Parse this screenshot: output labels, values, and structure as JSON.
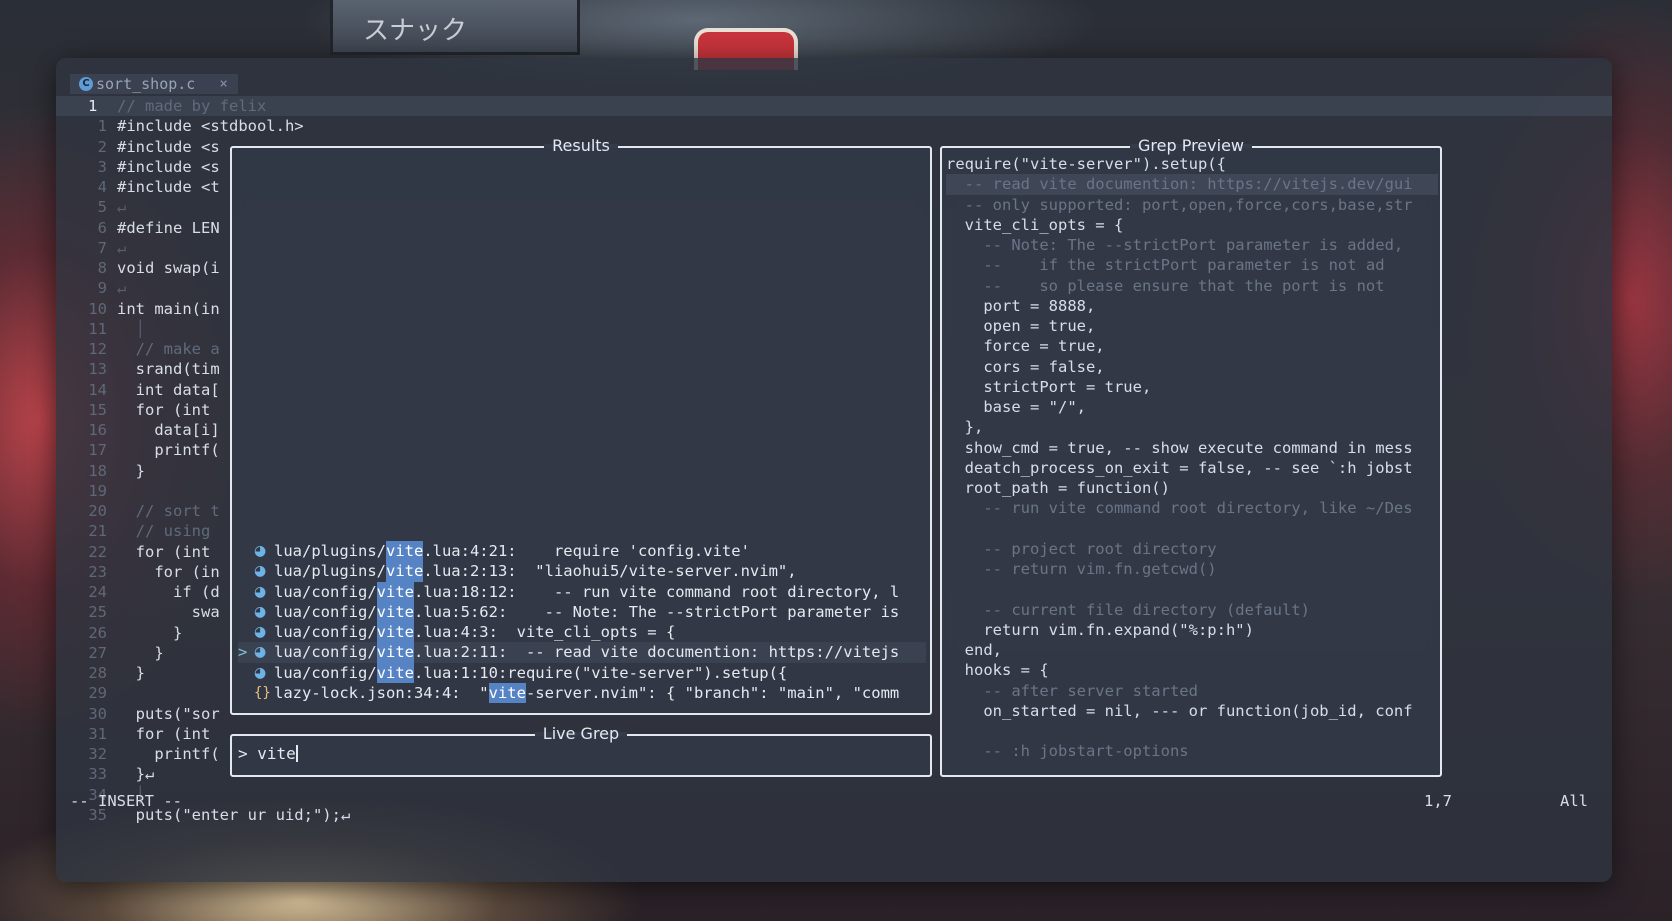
{
  "background": {
    "sign_text": "スナック"
  },
  "tab": {
    "filename": "sort_shop.c",
    "icon": "c-file-icon",
    "close_glyph": "×"
  },
  "editor": {
    "lines": [
      {
        "n": "1",
        "text": "// made by felix",
        "cls": "cmt",
        "cur": true
      },
      {
        "n": "1",
        "text": "#include <stdbool.h>"
      },
      {
        "n": "2",
        "text": "#include <s"
      },
      {
        "n": "3",
        "text": "#include <s"
      },
      {
        "n": "4",
        "text": "#include <t"
      },
      {
        "n": "5",
        "text": "↵",
        "cls": "eol"
      },
      {
        "n": "6",
        "text": "#define LEN"
      },
      {
        "n": "7",
        "text": "↵",
        "cls": "eol"
      },
      {
        "n": "8",
        "text": "void swap(i"
      },
      {
        "n": "9",
        "text": "↵",
        "cls": "eol"
      },
      {
        "n": "10",
        "text": "int main(in"
      },
      {
        "n": "11",
        "text": "  │",
        "cls": "guide"
      },
      {
        "n": "12",
        "text": "  // make a",
        "cls": "cmt"
      },
      {
        "n": "13",
        "text": "  srand(tim"
      },
      {
        "n": "14",
        "text": "  int data["
      },
      {
        "n": "15",
        "text": "  for (int "
      },
      {
        "n": "16",
        "text": "    data[i]"
      },
      {
        "n": "17",
        "text": "    printf("
      },
      {
        "n": "18",
        "text": "  }"
      },
      {
        "n": "19",
        "text": ""
      },
      {
        "n": "20",
        "text": "  // sort t",
        "cls": "cmt"
      },
      {
        "n": "21",
        "text": "  // using ",
        "cls": "cmt"
      },
      {
        "n": "22",
        "text": "  for (int "
      },
      {
        "n": "23",
        "text": "    for (in"
      },
      {
        "n": "24",
        "text": "      if (d"
      },
      {
        "n": "25",
        "text": "        swa"
      },
      {
        "n": "26",
        "text": "      }"
      },
      {
        "n": "27",
        "text": "    }"
      },
      {
        "n": "28",
        "text": "  }"
      },
      {
        "n": "29",
        "text": ""
      },
      {
        "n": "30",
        "text": "  puts(\"sor"
      },
      {
        "n": "31",
        "text": "  for (int "
      },
      {
        "n": "32",
        "text": "    printf("
      },
      {
        "n": "33",
        "text": "  }↵"
      },
      {
        "n": "34",
        "text": "  │",
        "cls": "guide"
      },
      {
        "n": "35",
        "text": "  puts(\"enter ur uid;\");↵"
      }
    ]
  },
  "status": {
    "mode": "-- INSERT --",
    "position": "1,7",
    "scroll": "All"
  },
  "results": {
    "title": "Results",
    "rows": [
      {
        "icon": "lua-icon",
        "glyph": "◕",
        "pre": "lua/plugins/",
        "match": "vite",
        "post": ".lua:4:21:    require 'config.vite'"
      },
      {
        "icon": "lua-icon",
        "glyph": "◕",
        "pre": "lua/plugins/",
        "match": "vite",
        "post": ".lua:2:13:  \"liaohui5/vite-server.nvim\","
      },
      {
        "icon": "lua-icon",
        "glyph": "◕",
        "pre": "lua/config/",
        "match": "vite",
        "post": ".lua:18:12:    -- run vite command root directory, l"
      },
      {
        "icon": "lua-icon",
        "glyph": "◕",
        "pre": "lua/config/",
        "match": "vite",
        "post": ".lua:5:62:    -- Note: The --strictPort parameter is"
      },
      {
        "icon": "lua-icon",
        "glyph": "◕",
        "pre": "lua/config/",
        "match": "vite",
        "post": ".lua:4:3:  vite_cli_opts = {"
      },
      {
        "icon": "lua-icon",
        "glyph": "◕",
        "pre": "lua/config/",
        "match": "vite",
        "post": ".lua:2:11:  -- read vite documention: https://vitejs",
        "selected": true
      },
      {
        "icon": "lua-icon",
        "glyph": "◕",
        "pre": "lua/config/",
        "match": "vite",
        "post": ".lua:1:10:require(\"vite-server\").setup({"
      },
      {
        "icon": "json-icon",
        "glyph": "{}",
        "pre": "lazy-lock.json:34:4:  \"",
        "match": "vite",
        "post": "-server.nvim\": { \"branch\": \"main\", \"comm"
      }
    ]
  },
  "preview": {
    "title": "Grep Preview",
    "lines": [
      "require(\"vite-server\").setup({",
      "  -- read vite documention: https://vitejs.dev/gui",
      "  -- only supported: port,open,force,cors,base,str",
      "  vite_cli_opts = {",
      "    -- Note: The --strictPort parameter is added,",
      "    --    if the strictPort parameter is not ad",
      "    --    so please ensure that the port is not",
      "    port = 8888,",
      "    open = true,",
      "    force = true,",
      "    cors = false,",
      "    strictPort = true,",
      "    base = \"/\",",
      "  },",
      "  show_cmd = true, -- show execute command in mess",
      "  deatch_process_on_exit = false, -- see `:h jobst",
      "  root_path = function()",
      "    -- run vite command root directory, like ~/Des",
      "",
      "    -- project root directory",
      "    -- return vim.fn.getcwd()",
      "",
      "    -- current file directory (default)",
      "    return vim.fn.expand(\"%:p:h\")",
      "  end,",
      "  hooks = {",
      "    -- after server started",
      "    on_started = nil, --- or function(job_id, conf",
      "",
      "    -- :h jobstart-options"
    ],
    "highlight_index": 1
  },
  "prompt": {
    "title": "Live Grep",
    "prefix": "> ",
    "query": "vite"
  },
  "colors": {
    "accent": "#5583c4",
    "border": "#e3e7ee",
    "text": "#d8dee9"
  }
}
